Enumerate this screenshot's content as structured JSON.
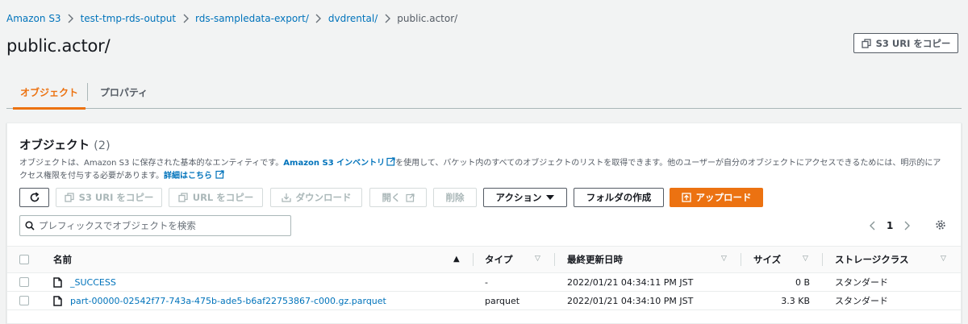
{
  "breadcrumb": [
    "Amazon S3",
    "test-tmp-rds-output",
    "rds-sampledata-export/",
    "dvdrental/",
    "public.actor/"
  ],
  "page_title": "public.actor/",
  "copy_s3_uri_label": "S3 URI をコピー",
  "tabs": [
    {
      "label": "オブジェクト",
      "active": true
    },
    {
      "label": "プロパティ",
      "active": false
    }
  ],
  "objects_panel": {
    "title": "オブジェクト",
    "count": "(2)",
    "desc_part1": "オブジェクトは、Amazon S3 に保存された基本的なエンティティです。",
    "desc_link1": "Amazon S3 インベントリ",
    "desc_part2": "を使用して、バケット内のすべてのオブジェクトのリストを取得できます。他のユーザーが自分のオブジェクトにアクセスできるためには、明示的にアクセス権限を付与する必要があります。",
    "desc_link2": "詳細はこちら"
  },
  "toolbar": {
    "copy_s3_uri": "S3 URI をコピー",
    "copy_url": "URL をコピー",
    "download": "ダウンロード",
    "open": "開く",
    "delete": "削除",
    "actions": "アクション",
    "create_folder": "フォルダの作成",
    "upload": "アップロード"
  },
  "search": {
    "placeholder": "プレフィックスでオブジェクトを検索",
    "value": ""
  },
  "pagination": {
    "current_page": "1"
  },
  "table": {
    "columns": {
      "name": "名前",
      "type": "タイプ",
      "last_modified": "最終更新日時",
      "size": "サイズ",
      "storage_class": "ストレージクラス"
    },
    "rows": [
      {
        "name": "_SUCCESS",
        "type": "-",
        "last_modified": "2022/01/21 04:34:11 PM JST",
        "size": "0 B",
        "storage_class": "スタンダード"
      },
      {
        "name": "part-00000-02542f77-743a-475b-ade5-b6af22753867-c000.gz.parquet",
        "type": "parquet",
        "last_modified": "2022/01/21 04:34:10 PM JST",
        "size": "3.3 KB",
        "storage_class": "スタンダード"
      }
    ]
  },
  "colors": {
    "accent": "#ec7211",
    "link": "#0073bb",
    "background": "#f2f3f3",
    "text": "#16191f",
    "muted": "#545b64"
  }
}
